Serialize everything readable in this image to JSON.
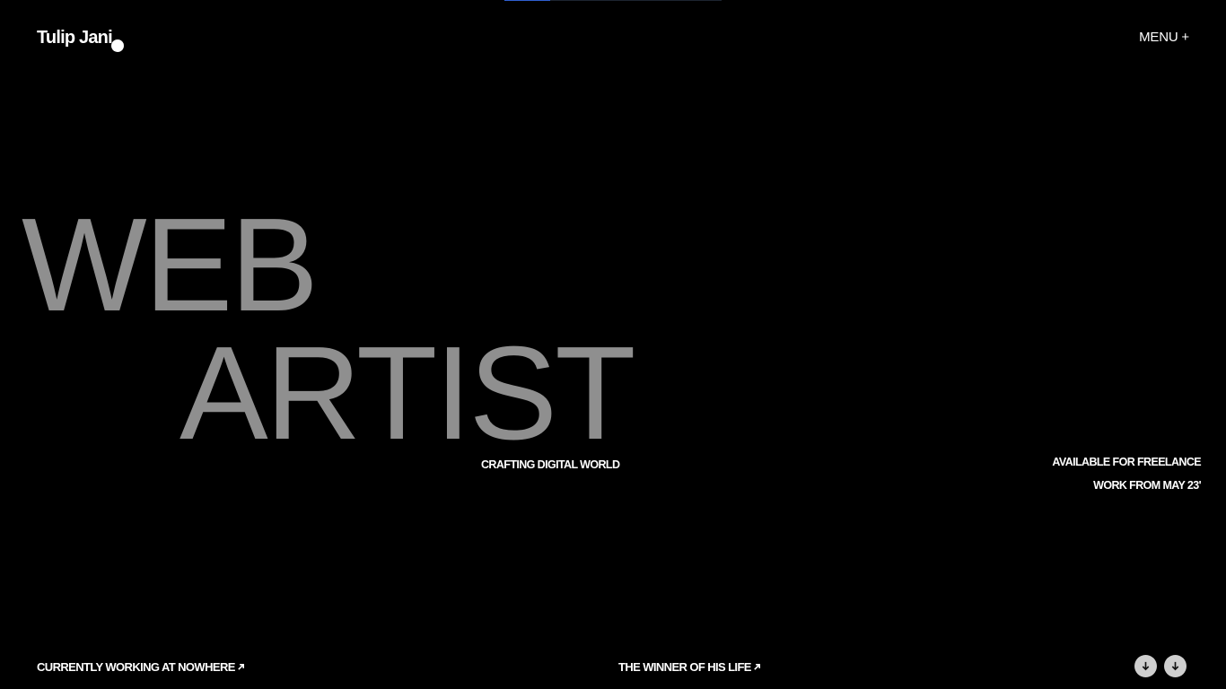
{
  "header": {
    "logo": "Tulip Jani",
    "menu_label": "MENU +"
  },
  "progress": {
    "fill_fraction": 0.21
  },
  "hero": {
    "line1": "WEB",
    "line2": "ARTIST",
    "tagline": "CRAFTING DIGITAL WORLD"
  },
  "availability": {
    "line1": "AVAILABLE FOR FREELANCE",
    "line2": "WORK FROM MAY 23'"
  },
  "footer": {
    "left_link": "CURRENTLY WORKING AT NOWHERE",
    "center_link": "THE WINNER OF HIS LIFE",
    "link_arrow_icon": "arrow-up-right-icon",
    "scroll_icon": "arrow-down-icon"
  },
  "colors": {
    "background": "#000000",
    "hero_text": "#8f8f8f",
    "accent": "#2f5fd0",
    "button_bg": "#cfcfcf"
  }
}
